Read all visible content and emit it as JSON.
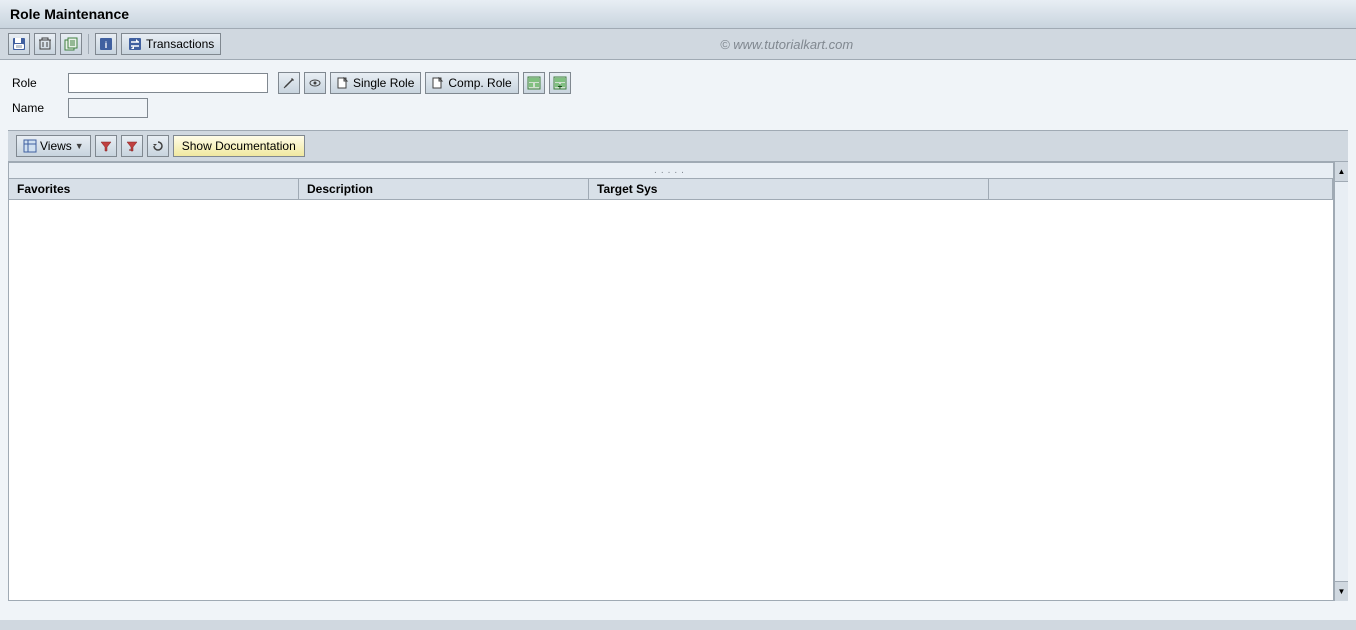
{
  "title": "Role Maintenance",
  "toolbar": {
    "transactions_label": "Transactions",
    "watermark": "© www.tutorialkart.com"
  },
  "form": {
    "role_label": "Role",
    "name_label": "Name",
    "role_placeholder": "",
    "name_placeholder": "",
    "single_role_label": "Single Role",
    "comp_role_label": "Comp. Role"
  },
  "secondary_toolbar": {
    "views_label": "Views",
    "show_documentation_label": "Show Documentation"
  },
  "table": {
    "dots": ".....",
    "columns": [
      {
        "key": "favorites",
        "label": "Favorites"
      },
      {
        "key": "description",
        "label": "Description"
      },
      {
        "key": "target_sys",
        "label": "Target Sys"
      },
      {
        "key": "extra",
        "label": ""
      }
    ],
    "rows": []
  },
  "icons": {
    "save": "💾",
    "delete": "🗑",
    "copy": "📋",
    "info": "ℹ",
    "transactions": "↕",
    "pencil": "✏",
    "display": "👁",
    "doc_page": "📄",
    "grid_save": "📊",
    "grid_add": "➕",
    "views_dropdown": "▼",
    "filter": "▽",
    "filter_active": "▼",
    "refresh": "↺"
  },
  "colors": {
    "title_bg_start": "#e8eef4",
    "title_bg_end": "#c8d4de",
    "toolbar_bg": "#d0d8e0",
    "content_bg": "#f0f4f8",
    "button_bg": "#fffde8",
    "grid_header_bg": "#d8e0e8",
    "accent": "#4060a0"
  }
}
